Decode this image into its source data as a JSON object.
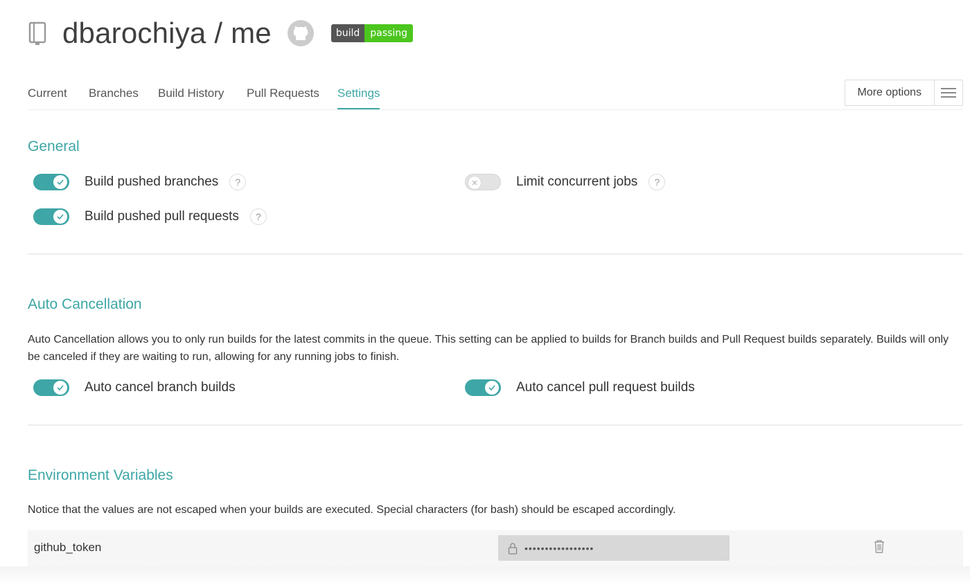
{
  "header": {
    "repo_title": "dbarochiya / me",
    "badge": {
      "left": "build",
      "right": "passing",
      "color": "#4cc61e"
    }
  },
  "tabs": [
    {
      "label": "Current"
    },
    {
      "label": "Branches"
    },
    {
      "label": "Build History"
    },
    {
      "label": "Pull Requests"
    },
    {
      "label": "Settings",
      "active": true
    }
  ],
  "more_options": {
    "label": "More options"
  },
  "general": {
    "title": "General",
    "settings": [
      {
        "label": "Build pushed branches",
        "enabled": true,
        "help": "?"
      },
      {
        "label": "Limit concurrent jobs",
        "enabled": false,
        "help": "?"
      },
      {
        "label": "Build pushed pull requests",
        "enabled": true,
        "help": "?"
      }
    ]
  },
  "auto_cancellation": {
    "title": "Auto Cancellation",
    "description": "Auto Cancellation allows you to only run builds for the latest commits in the queue. This setting can be applied to builds for Branch builds and Pull Request builds separately. Builds will only be canceled if they are waiting to run, allowing for any running jobs to finish.",
    "settings": [
      {
        "label": "Auto cancel branch builds",
        "enabled": true
      },
      {
        "label": "Auto cancel pull request builds",
        "enabled": true
      }
    ]
  },
  "env_vars": {
    "title": "Environment Variables",
    "description": "Notice that the values are not escaped when your builds are executed. Special characters (for bash) should be escaped accordingly.",
    "rows": [
      {
        "name": "github_token",
        "value": "•••••••••••••••••"
      }
    ]
  },
  "icons": [
    "repo-icon",
    "github-icon",
    "menu-icon",
    "check-icon",
    "x-icon",
    "lock-icon",
    "trash-icon"
  ],
  "colors": {
    "accent": "#3ea6a6",
    "badge_dark": "#555555",
    "badge_green": "#4cc61e"
  }
}
